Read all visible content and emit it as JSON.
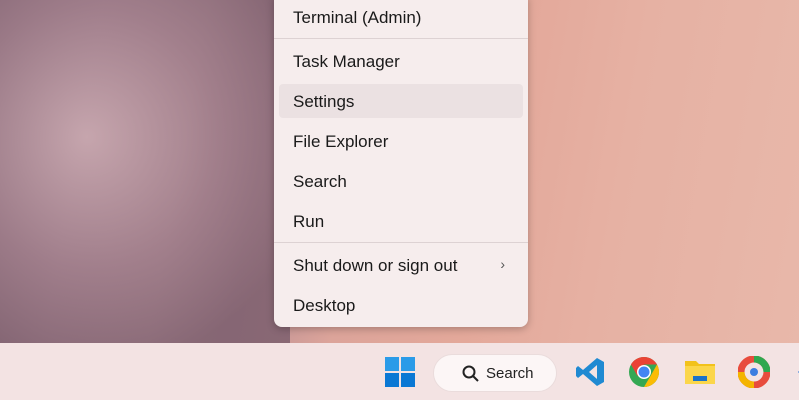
{
  "menu": {
    "items": [
      "Terminal (Admin)",
      "Task Manager",
      "Settings",
      "File Explorer",
      "Search",
      "Run",
      "Shut down or sign out",
      "Desktop"
    ]
  },
  "taskbar": {
    "search_label": "Search"
  }
}
